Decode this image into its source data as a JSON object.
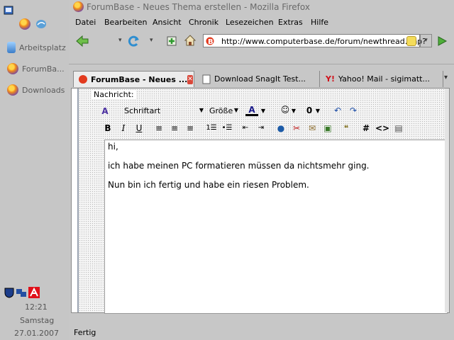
{
  "taskbar": {
    "items": [
      {
        "label": "Arbeitsplatz",
        "icon": "computer-icon"
      },
      {
        "label": "ForumBa...",
        "icon": "firefox-icon"
      },
      {
        "label": "Downloads",
        "icon": "firefox-icon"
      }
    ],
    "clock": "12:21",
    "weekday": "Samstag",
    "date": "27.01.2007"
  },
  "window": {
    "title": "ForumBase - Neues Thema erstellen - Mozilla Firefox"
  },
  "menu": {
    "items": [
      "Datei",
      "Bearbeiten",
      "Ansicht",
      "Chronik",
      "Lesezeichen",
      "Extras",
      "Hilfe"
    ]
  },
  "navbar": {
    "url": "http://www.computerbase.de/forum/newthread.php?"
  },
  "tabs": [
    {
      "label": "ForumBase - Neues ...",
      "active": true
    },
    {
      "label": "Download SnagIt Test...",
      "active": false
    },
    {
      "label": "Yahoo! Mail - sigimatt...",
      "active": false
    }
  ],
  "editor": {
    "label": "Nachricht:",
    "font_select": "Schriftart",
    "size_select": "Größe",
    "lines": [
      "hi,",
      "ich habe meinen PC formatieren müssen da nichtsmehr ging.",
      "Nun bin ich fertig und habe ein riesen Problem."
    ]
  },
  "status": {
    "text": "Fertig"
  }
}
